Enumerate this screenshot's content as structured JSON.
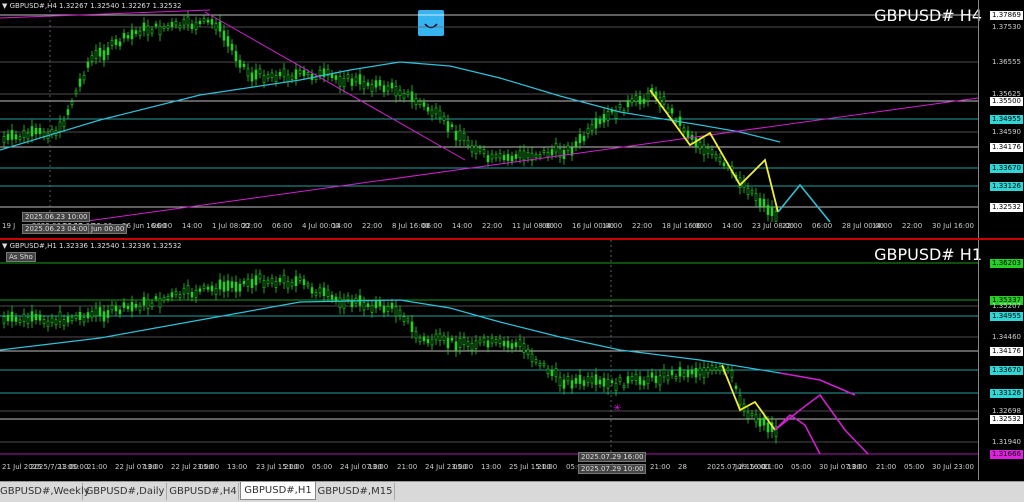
{
  "top": {
    "header": "▼ GBPUSD#,H4  1.32267 1.32540 1.32267 1.32532",
    "symbol": "GBPUSD#  H4",
    "prices": [
      "1.37869",
      "1.37530",
      "1.36555",
      "1.35625",
      "1.35500",
      "1.34955",
      "1.34590",
      "1.34176",
      "1.33670",
      "1.33126",
      "1.32532"
    ],
    "price_colors": [
      "#ffffff",
      "#cccccc",
      "#cccccc",
      "#cccccc",
      "#ffffff",
      "#30d5d5",
      "#cccccc",
      "#ffffff",
      "#30d5d5",
      "#30d5d5",
      "#ffffff"
    ],
    "times": [
      "19 J",
      "2025.06.23 10:00",
      "14:00",
      "22:00",
      "26 Jun 16:00",
      "06:00",
      "14:00",
      "1 Jul 08:00",
      "22:00",
      "06:00",
      "4 Jul 00:00",
      "14:00",
      "22:00",
      "8 Jul 16:00",
      "06:00",
      "14:00",
      "22:00",
      "11 Jul 08:00",
      "06:00",
      "16 Jul 00:00",
      "14:00",
      "22:00",
      "18 Jul 16:00",
      "06:00",
      "14:00",
      "23 Jul 08:00",
      "22:00",
      "06:00",
      "28 Jul 00:00",
      "14:00",
      "22:00",
      "30 Jul 16:00"
    ],
    "crosshair_tags": [
      "2025.06.23 10:00",
      "2025.06.23 04:00",
      "Jun 00:00"
    ]
  },
  "bottom": {
    "header": "▼ GBPUSD#,H1  1.32336 1.32540 1.32336 1.32532",
    "symbol": "GBPUSD#  H1",
    "as_show": "As Sho",
    "prices": [
      "1.36203",
      "1.35337",
      "1.35207",
      "1.34955",
      "1.34460",
      "1.34176",
      "1.33670",
      "1.33126",
      "1.32698",
      "1.32532",
      "1.31940",
      "1.31666"
    ],
    "price_colors": [
      "#22d122",
      "#22d122",
      "#cccccc",
      "#30d5d5",
      "#cccccc",
      "#ffffff",
      "#30d5d5",
      "#30d5d5",
      "#cccccc",
      "#ffffff",
      "#cccccc",
      "#e020e0"
    ],
    "times": [
      "21 Jul 2025",
      "2025/7/21 05:00",
      "13:00",
      "21:00",
      "22 Jul 07:00",
      "13:00",
      "22 Jul 23:00",
      "05:00",
      "13:00",
      "23 Jul 15:00",
      "21:00",
      "05:00",
      "24 Jul 07:00",
      "13:00",
      "21:00",
      "24 Jul 23:00",
      "05:00",
      "13:00",
      "25 Jul 15:00",
      "21:00",
      "05:00",
      "28 Jul 07:00",
      "13:00",
      "21:00",
      "28",
      "2025.07.29 16:00",
      "Jul 15:00",
      "21:00",
      "05:00",
      "30 Jul 07:00",
      "13:00",
      "21:00",
      "05:00",
      "30 Jul 23:00"
    ],
    "crosshair_tags": [
      "2025.07.29 16:00",
      "2025.07.29 10:00"
    ]
  },
  "tabs": [
    "GBPUSD#,Weekly",
    "GBPUSD#,Daily",
    "GBPUSD#,H4",
    "GBPUSD#,H1",
    "GBPUSD#,M15"
  ],
  "active_tab": 3,
  "colors": {
    "candle": "#22d122",
    "ma": "#30c0d8",
    "trend": "#d020d0",
    "zigzag": "#f0f030",
    "hline": "#ffffff",
    "green": "#22d122"
  }
}
